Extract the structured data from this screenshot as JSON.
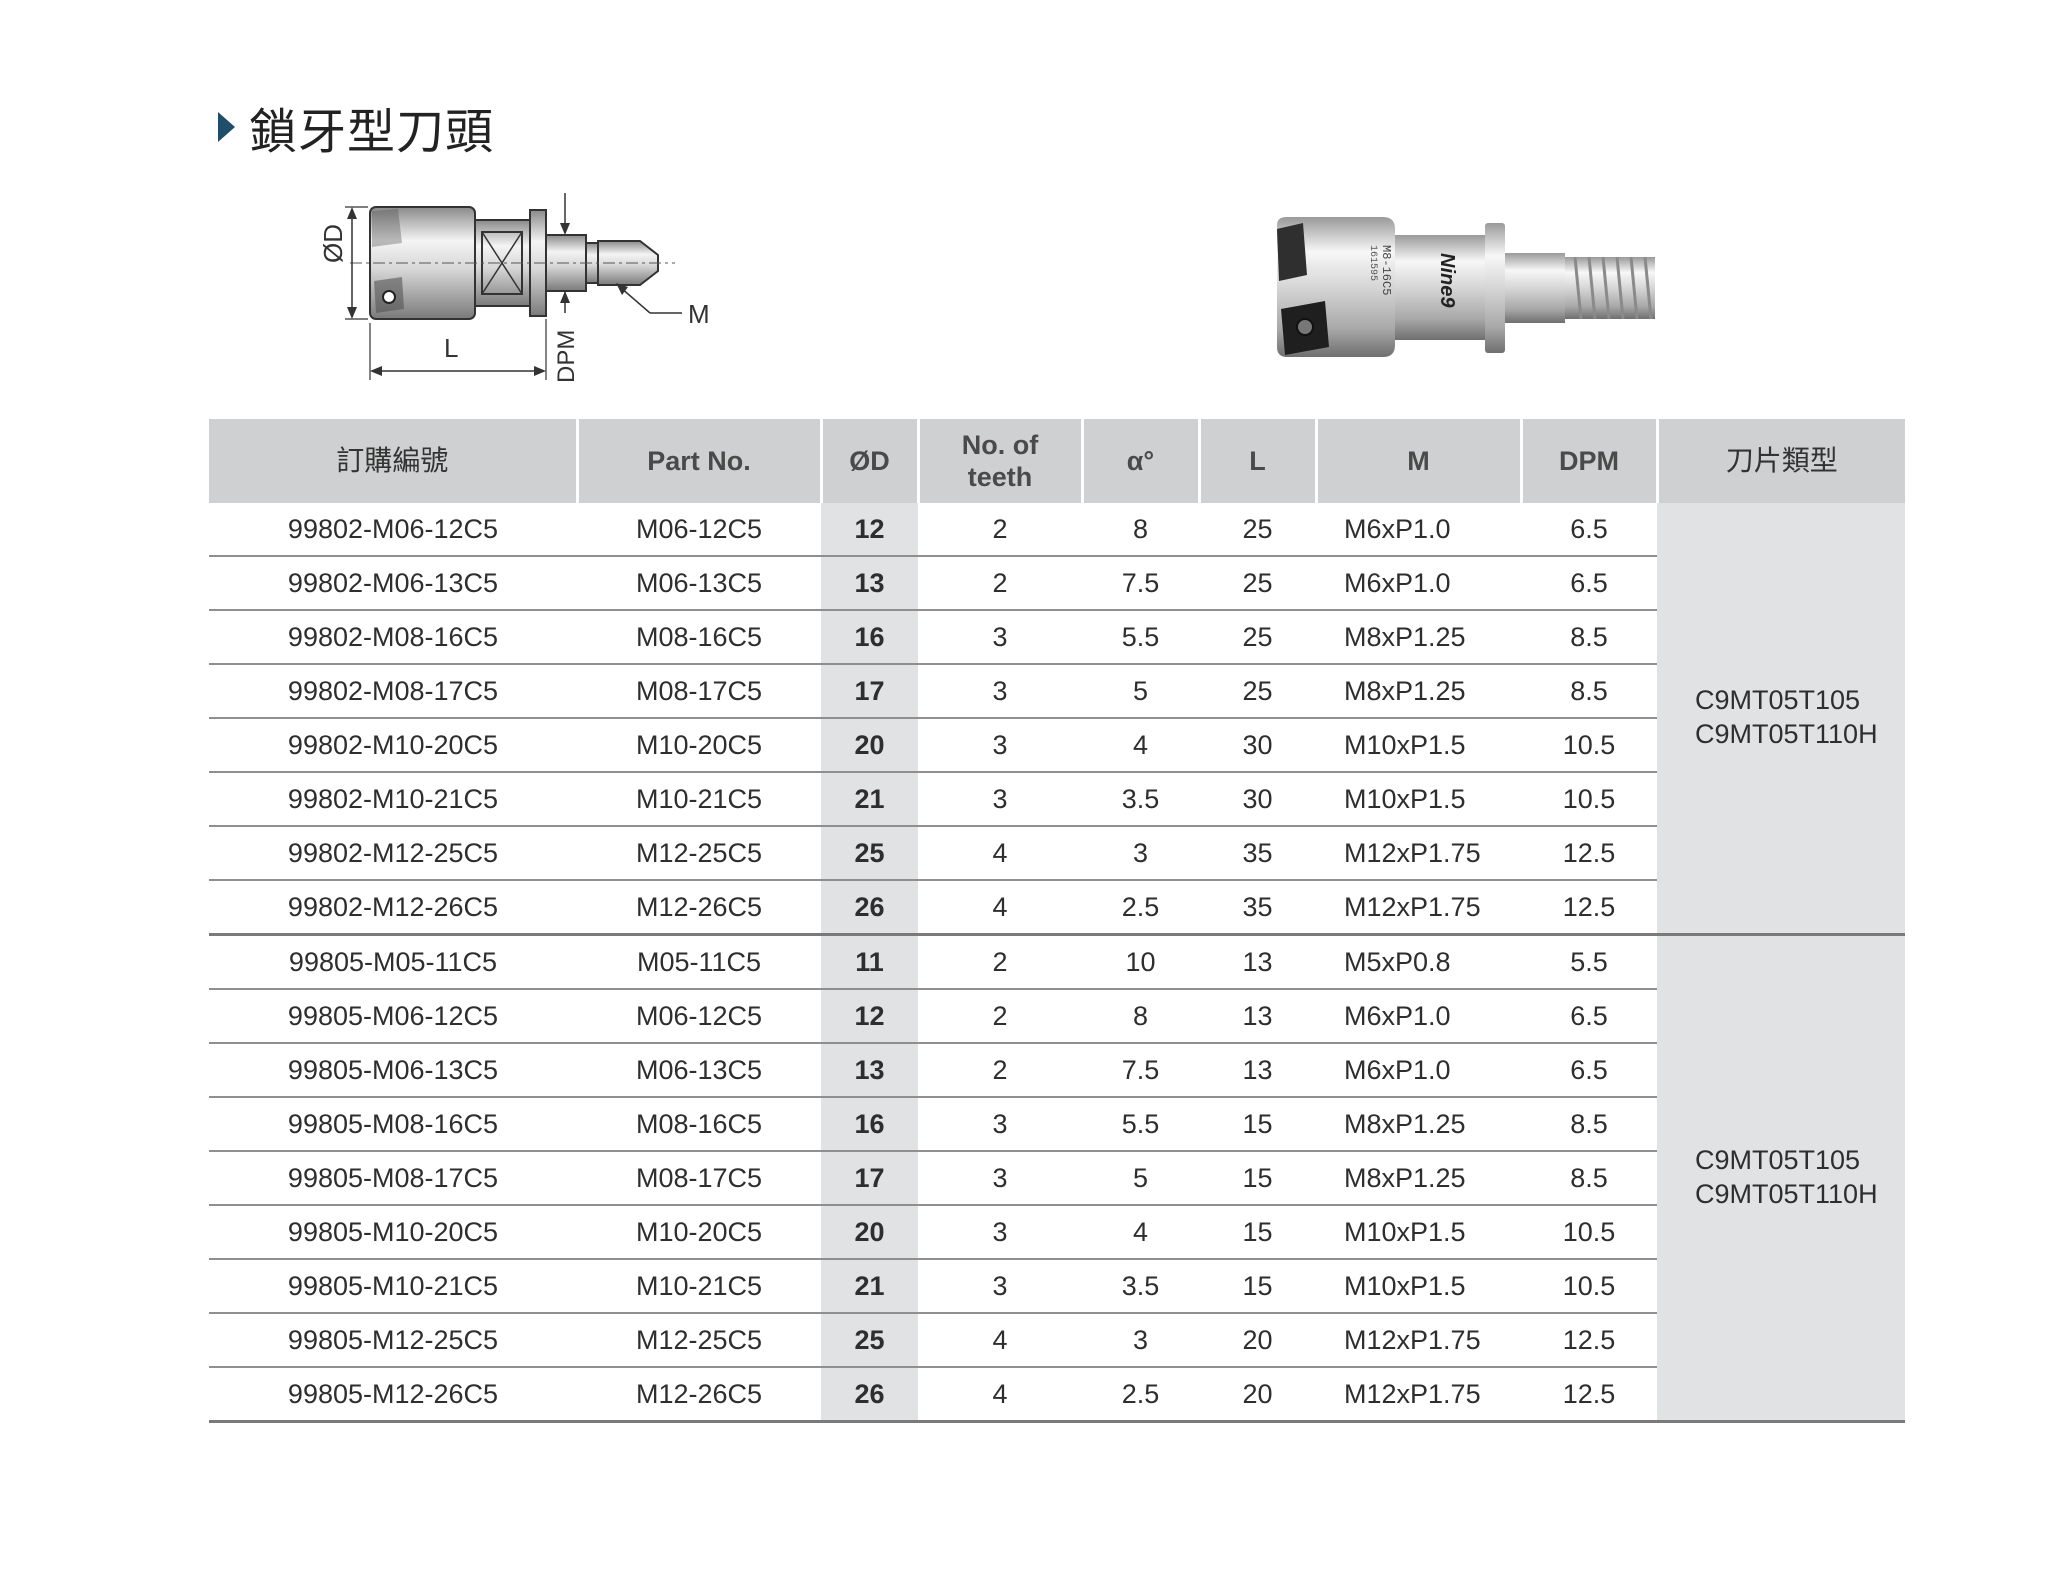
{
  "title": "鎖牙型刀頭",
  "diagram": {
    "label_d": "ØD",
    "label_l": "L",
    "label_m": "M",
    "label_dpm": "DPM"
  },
  "photo": {
    "engraving_brand": "Nine9",
    "engraving_part": "M8-16C5",
    "engraving_code": "161595"
  },
  "table": {
    "headers": [
      "訂購編號",
      "Part No.",
      "ØD",
      "No. of teeth",
      "α°",
      "L",
      "M",
      "DPM",
      "刀片類型"
    ],
    "groups": [
      {
        "insert_type": [
          "C9MT05T105",
          "C9MT05T110H"
        ],
        "rows": [
          [
            "99802-M06-12C5",
            "M06-12C5",
            "12",
            "2",
            "8",
            "25",
            "M6xP1.0",
            "6.5"
          ],
          [
            "99802-M06-13C5",
            "M06-13C5",
            "13",
            "2",
            "7.5",
            "25",
            "M6xP1.0",
            "6.5"
          ],
          [
            "99802-M08-16C5",
            "M08-16C5",
            "16",
            "3",
            "5.5",
            "25",
            "M8xP1.25",
            "8.5"
          ],
          [
            "99802-M08-17C5",
            "M08-17C5",
            "17",
            "3",
            "5",
            "25",
            "M8xP1.25",
            "8.5"
          ],
          [
            "99802-M10-20C5",
            "M10-20C5",
            "20",
            "3",
            "4",
            "30",
            "M10xP1.5",
            "10.5"
          ],
          [
            "99802-M10-21C5",
            "M10-21C5",
            "21",
            "3",
            "3.5",
            "30",
            "M10xP1.5",
            "10.5"
          ],
          [
            "99802-M12-25C5",
            "M12-25C5",
            "25",
            "4",
            "3",
            "35",
            "M12xP1.75",
            "12.5"
          ],
          [
            "99802-M12-26C5",
            "M12-26C5",
            "26",
            "4",
            "2.5",
            "35",
            "M12xP1.75",
            "12.5"
          ]
        ]
      },
      {
        "insert_type": [
          "C9MT05T105",
          "C9MT05T110H"
        ],
        "rows": [
          [
            "99805-M05-11C5",
            "M05-11C5",
            "11",
            "2",
            "10",
            "13",
            "M5xP0.8",
            "5.5"
          ],
          [
            "99805-M06-12C5",
            "M06-12C5",
            "12",
            "2",
            "8",
            "13",
            "M6xP1.0",
            "6.5"
          ],
          [
            "99805-M06-13C5",
            "M06-13C5",
            "13",
            "2",
            "7.5",
            "13",
            "M6xP1.0",
            "6.5"
          ],
          [
            "99805-M08-16C5",
            "M08-16C5",
            "16",
            "3",
            "5.5",
            "15",
            "M8xP1.25",
            "8.5"
          ],
          [
            "99805-M08-17C5",
            "M08-17C5",
            "17",
            "3",
            "5",
            "15",
            "M8xP1.25",
            "8.5"
          ],
          [
            "99805-M10-20C5",
            "M10-20C5",
            "20",
            "3",
            "4",
            "15",
            "M10xP1.5",
            "10.5"
          ],
          [
            "99805-M10-21C5",
            "M10-21C5",
            "21",
            "3",
            "3.5",
            "15",
            "M10xP1.5",
            "10.5"
          ],
          [
            "99805-M12-25C5",
            "M12-25C5",
            "25",
            "4",
            "3",
            "20",
            "M12xP1.75",
            "12.5"
          ],
          [
            "99805-M12-26C5",
            "M12-26C5",
            "26",
            "4",
            "2.5",
            "20",
            "M12xP1.75",
            "12.5"
          ]
        ]
      }
    ]
  }
}
